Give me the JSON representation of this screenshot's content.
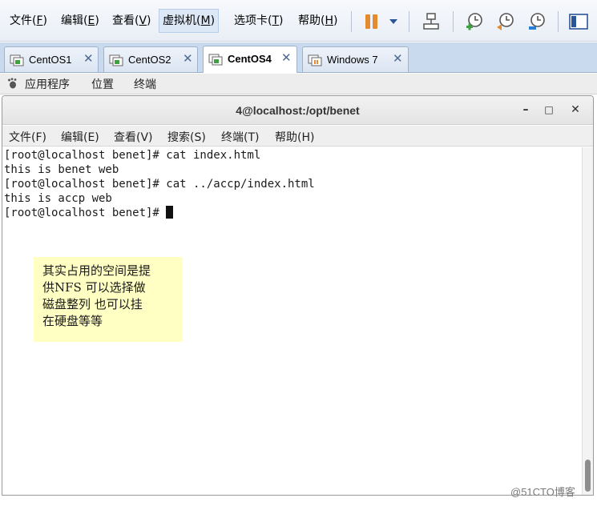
{
  "vmware_menu": [
    {
      "label": "文件(",
      "key": "F",
      "tail": ")"
    },
    {
      "label": "编辑(",
      "key": "E",
      "tail": ")"
    },
    {
      "label": "查看(",
      "key": "V",
      "tail": ")"
    },
    {
      "label": "虚拟机(",
      "key": "M",
      "tail": ")"
    },
    {
      "label": "选项卡(",
      "key": "T",
      "tail": ")"
    },
    {
      "label": "帮助(",
      "key": "H",
      "tail": ")"
    }
  ],
  "vm_tabs": [
    {
      "label": "CentOS1"
    },
    {
      "label": "CentOS2"
    },
    {
      "label": "CentOS4"
    },
    {
      "label": "Windows 7"
    }
  ],
  "gnome_panel": {
    "applications": "应用程序",
    "places": "位置",
    "terminal": "终端"
  },
  "terminal": {
    "title": "4@localhost:/opt/benet",
    "minimize": "–",
    "maximize": "□",
    "close": "✕",
    "menu": [
      "文件(F)",
      "编辑(E)",
      "查看(V)",
      "搜索(S)",
      "终端(T)",
      "帮助(H)"
    ],
    "lines": [
      "[root@localhost benet]# cat index.html",
      "this is benet web",
      "[root@localhost benet]# cat ../accp/index.html",
      "this is accp web",
      "[root@localhost benet]# "
    ]
  },
  "note": {
    "lines": [
      "其实占用的空间是提",
      "供NFS 可以选择做",
      "磁盘整列 也可以挂",
      "在硬盘等等"
    ]
  },
  "watermark": "@51CTO博客",
  "icons": {
    "pause": "pause-icon",
    "dropdown": "chevron-down-icon",
    "network": "network-icon",
    "snapshot": "snapshot-icon",
    "revert": "revert-snapshot-icon",
    "manage": "snapshot-manager-icon",
    "view": "console-view-icon",
    "vm_tab": "vm-icon",
    "close": "close-icon",
    "gnome": "gnome-foot-icon"
  },
  "colors": {
    "accent": "#2a5599",
    "pause": "#e38b2e",
    "note_bg": "#ffffc4"
  }
}
